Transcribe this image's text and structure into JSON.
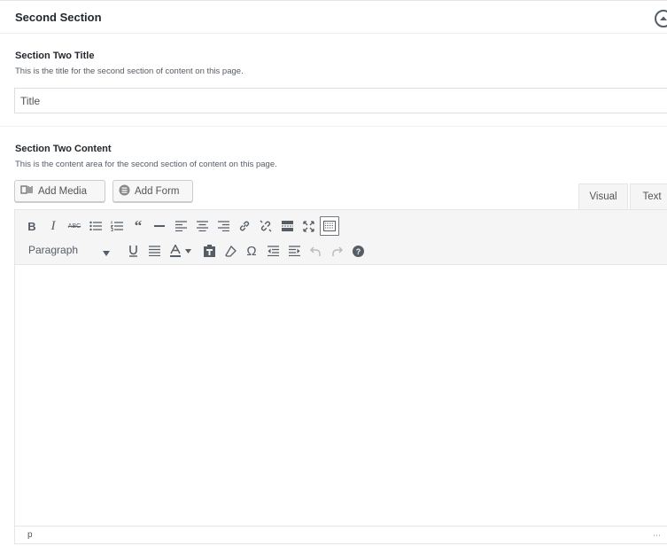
{
  "section": {
    "title": "Second Section",
    "toggle_icon": "arrow-up-icon"
  },
  "title_field": {
    "label": "Section Two Title",
    "description": "This is the title for the second section of content on this page.",
    "value": "Title"
  },
  "content_field": {
    "label": "Section Two Content",
    "description": "This is the content area for the second section of content on this page."
  },
  "media_buttons": {
    "add_media": "Add Media",
    "add_form": "Add Form"
  },
  "editor_tabs": {
    "visual": "Visual",
    "text": "Text"
  },
  "toolbar": {
    "row1": [
      "bold",
      "italic",
      "strikethrough",
      "bullet-list",
      "numbered-list",
      "blockquote",
      "horizontal-line",
      "align-left",
      "align-center",
      "align-right",
      "insert-link",
      "remove-link",
      "read-more",
      "fullscreen",
      "toolbar-toggle"
    ],
    "row2": [
      "underline",
      "justify",
      "text-color",
      "paste-as-text",
      "clear-formatting",
      "special-character",
      "decrease-indent",
      "increase-indent",
      "undo",
      "redo",
      "help"
    ],
    "format_value": "Paragraph"
  },
  "statusbar": {
    "path": "p"
  }
}
